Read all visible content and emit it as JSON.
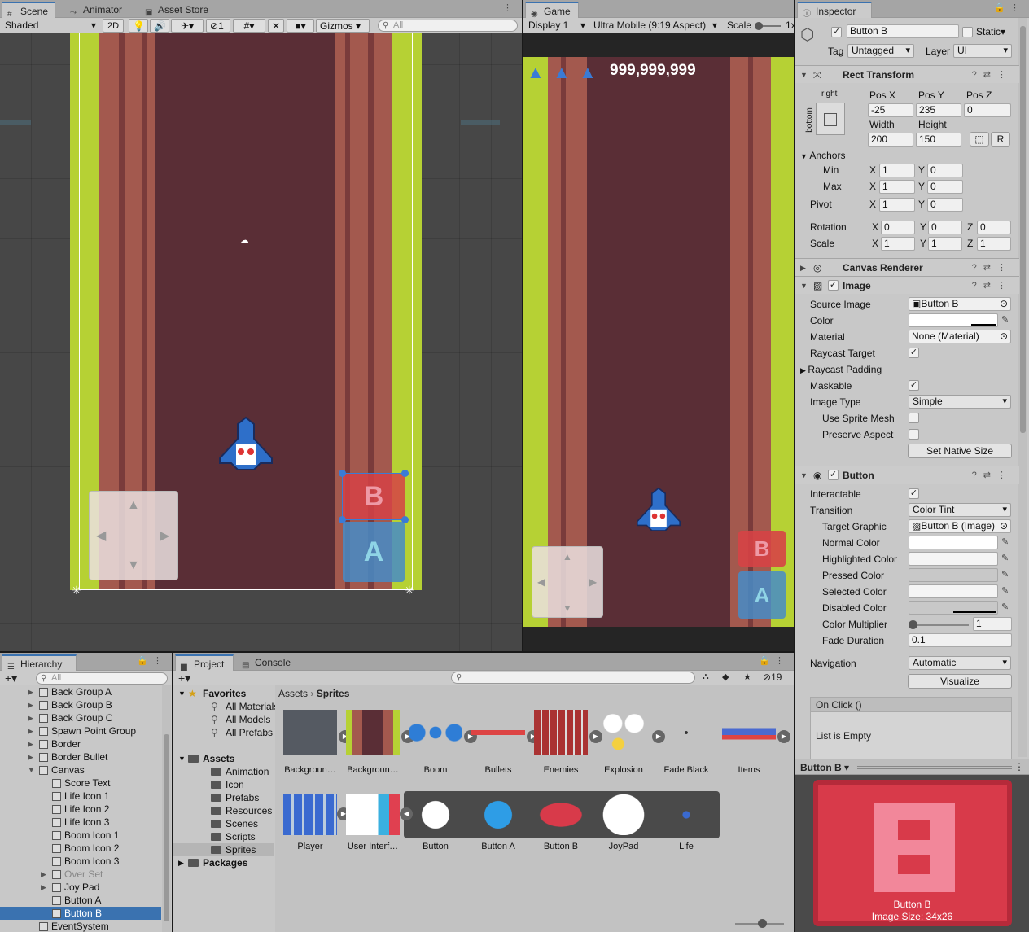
{
  "scene": {
    "tab_scene": "Scene",
    "tab_animator": "Animator",
    "tab_asset_store": "Asset Store",
    "shading": "Shaded",
    "mode_2d": "2D",
    "hidden_count": "1",
    "gizmos": "Gizmos",
    "search_placeholder": "All"
  },
  "game": {
    "tab": "Game",
    "display": "Display 1",
    "aspect": "Ultra Mobile (9:19 Aspect)",
    "scale_label": "Scale",
    "scale_value": "1x",
    "score": "999,999,999"
  },
  "inspector": {
    "tab": "Inspector",
    "object_name": "Button B",
    "static_label": "Static",
    "tag_label": "Tag",
    "tag_value": "Untagged",
    "layer_label": "Layer",
    "layer_value": "UI",
    "rect": {
      "title": "Rect Transform",
      "anchor_h": "right",
      "anchor_v": "bottom",
      "posx_label": "Pos X",
      "posy_label": "Pos Y",
      "posz_label": "Pos Z",
      "posx": "-25",
      "posy": "235",
      "posz": "0",
      "width_label": "Width",
      "height_label": "Height",
      "width": "200",
      "height": "150",
      "r_button": "R",
      "anchors": "Anchors",
      "min": "Min",
      "max": "Max",
      "min_x": "1",
      "min_y": "0",
      "max_x": "1",
      "max_y": "0",
      "pivot": "Pivot",
      "pivot_x": "1",
      "pivot_y": "0",
      "rotation": "Rotation",
      "rot_x": "0",
      "rot_y": "0",
      "rot_z": "0",
      "scale": "Scale",
      "scale_x": "1",
      "scale_y": "1",
      "scale_z": "1",
      "x": "X",
      "y": "Y",
      "z": "Z"
    },
    "canvas_renderer": "Canvas Renderer",
    "image": {
      "title": "Image",
      "source_image_label": "Source Image",
      "source_image": "Button B",
      "color_label": "Color",
      "material_label": "Material",
      "material": "None (Material)",
      "raycast_target": "Raycast Target",
      "raycast_padding": "Raycast Padding",
      "maskable": "Maskable",
      "image_type_label": "Image Type",
      "image_type": "Simple",
      "use_sprite_mesh": "Use Sprite Mesh",
      "preserve_aspect": "Preserve Aspect",
      "set_native_size": "Set Native Size"
    },
    "button": {
      "title": "Button",
      "interactable": "Interactable",
      "transition_label": "Transition",
      "transition": "Color Tint",
      "target_graphic_label": "Target Graphic",
      "target_graphic": "Button B (Image)",
      "normal": "Normal Color",
      "highlighted": "Highlighted Color",
      "pressed": "Pressed Color",
      "selected": "Selected Color",
      "disabled": "Disabled Color",
      "multiplier_label": "Color Multiplier",
      "multiplier": "1",
      "fade_label": "Fade Duration",
      "fade": "0.1",
      "navigation_label": "Navigation",
      "navigation": "Automatic",
      "visualize": "Visualize",
      "onclick": "On Click ()",
      "list_empty": "List is Empty"
    },
    "preview": {
      "title": "Button B",
      "name": "Button B",
      "size": "Image Size: 34x26"
    }
  },
  "hierarchy": {
    "tab": "Hierarchy",
    "search_placeholder": "All",
    "rows": [
      {
        "label": "Back Group A",
        "indent": 3,
        "fold": "▶"
      },
      {
        "label": "Back Group B",
        "indent": 3,
        "fold": "▶"
      },
      {
        "label": "Back Group C",
        "indent": 3,
        "fold": "▶"
      },
      {
        "label": "Spawn Point Group",
        "indent": 3,
        "fold": "▶"
      },
      {
        "label": "Border",
        "indent": 3,
        "fold": "▶"
      },
      {
        "label": "Border Bullet",
        "indent": 3,
        "fold": "▶"
      },
      {
        "label": "Canvas",
        "indent": 3,
        "fold": "▼"
      },
      {
        "label": "Score Text",
        "indent": 4,
        "fold": ""
      },
      {
        "label": "Life Icon 1",
        "indent": 4,
        "fold": ""
      },
      {
        "label": "Life Icon 2",
        "indent": 4,
        "fold": ""
      },
      {
        "label": "Life Icon 3",
        "indent": 4,
        "fold": ""
      },
      {
        "label": "Boom Icon 1",
        "indent": 4,
        "fold": ""
      },
      {
        "label": "Boom Icon 2",
        "indent": 4,
        "fold": ""
      },
      {
        "label": "Boom Icon 3",
        "indent": 4,
        "fold": ""
      },
      {
        "label": "Over Set",
        "indent": 4,
        "fold": "▶",
        "dim": true
      },
      {
        "label": "Joy Pad",
        "indent": 4,
        "fold": "▶"
      },
      {
        "label": "Button A",
        "indent": 4,
        "fold": ""
      },
      {
        "label": "Button B",
        "indent": 4,
        "fold": "",
        "selected": true
      },
      {
        "label": "EventSystem",
        "indent": 3,
        "fold": ""
      }
    ]
  },
  "project": {
    "tab_project": "Project",
    "tab_console": "Console",
    "hidden_count": "19",
    "breadcrumb_root": "Assets",
    "breadcrumb_current": "Sprites",
    "tree": [
      {
        "label": "Favorites",
        "indent": 0,
        "bold": true,
        "fold": "▼",
        "icon": "star"
      },
      {
        "label": "All Materials",
        "indent": 2,
        "icon": "search"
      },
      {
        "label": "All Models",
        "indent": 2,
        "icon": "search"
      },
      {
        "label": "All Prefabs",
        "indent": 2,
        "icon": "search"
      },
      {
        "label": "Assets",
        "indent": 0,
        "bold": true,
        "fold": "▼",
        "icon": "folder",
        "gap": true
      },
      {
        "label": "Animation",
        "indent": 2,
        "icon": "folder"
      },
      {
        "label": "Icon",
        "indent": 2,
        "icon": "folder"
      },
      {
        "label": "Prefabs",
        "indent": 2,
        "icon": "folder"
      },
      {
        "label": "Resources",
        "indent": 2,
        "icon": "folder"
      },
      {
        "label": "Scenes",
        "indent": 2,
        "icon": "folder"
      },
      {
        "label": "Scripts",
        "indent": 2,
        "icon": "folder"
      },
      {
        "label": "Sprites",
        "indent": 2,
        "icon": "folder",
        "selected": true
      },
      {
        "label": "Packages",
        "indent": 0,
        "bold": true,
        "fold": "▶",
        "icon": "folder"
      }
    ],
    "assets_row1": [
      "Backgroun…",
      "Backgroun…",
      "Boom",
      "Bullets",
      "Enemies",
      "Explosion",
      "Fade Black",
      "Items"
    ],
    "assets_row2": [
      "Player",
      "User Interf…",
      "Button",
      "Button A",
      "Button B",
      "JoyPad",
      "Life"
    ]
  }
}
